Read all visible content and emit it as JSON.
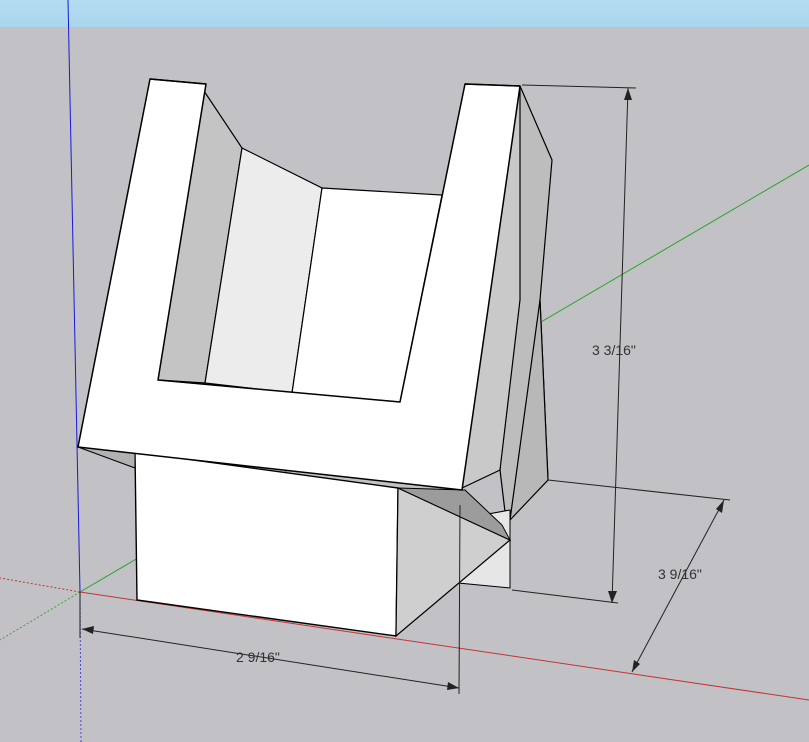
{
  "viewport": {
    "sky_color": "#a9d6ee",
    "ground_color": "#c1c1c6"
  },
  "axes": {
    "blue_axis_color": "#1a1ad6",
    "green_axis_color": "#26a826",
    "red_axis_color": "#c83232"
  },
  "model": {
    "face_white": "#ffffff",
    "face_light": "#ececec",
    "face_mid": "#cdcdcd",
    "face_dark": "#a8a8a8",
    "edge_color": "#000000"
  },
  "dimensions": {
    "height_label": "3 3/16\"",
    "depth_label": "3 9/16\"",
    "width_label": "2 9/16\""
  }
}
